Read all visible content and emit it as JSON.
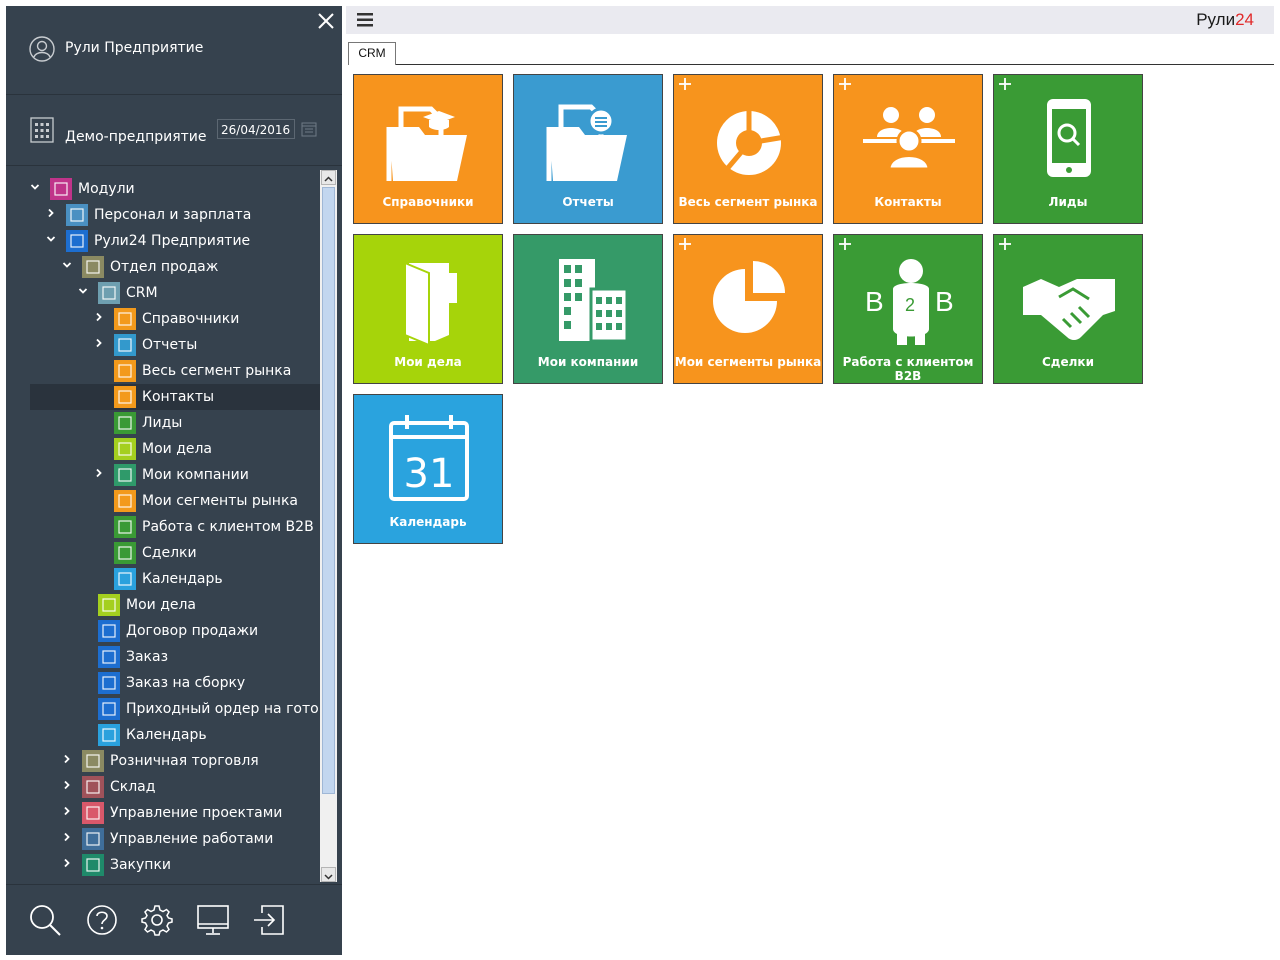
{
  "user": {
    "name": "Рули Предприятие"
  },
  "company": {
    "name": "Демо-предприятие",
    "date": "26/04/2016"
  },
  "tree": [
    {
      "label": "Модули",
      "icon": "modules-icon",
      "color": "#c0348a",
      "arrow": "down"
    },
    {
      "label": "Персонал и зарплата",
      "icon": "personnel-icon",
      "color": "#4a90c2",
      "arrow": "right"
    },
    {
      "label": "Рули24 Предприятие",
      "icon": "enterprise-icon",
      "color": "#1d6ed0",
      "arrow": "down"
    },
    {
      "label": "Отдел продаж",
      "icon": "sales-dept-icon",
      "color": "#8b8a62",
      "arrow": "down"
    },
    {
      "label": "CRM",
      "icon": "crm-icon",
      "color": "#6e9fb0",
      "arrow": "down"
    },
    {
      "label": "Справочники",
      "icon": "folder-icon",
      "color": "#f39a1c",
      "arrow": "right"
    },
    {
      "label": "Отчеты",
      "icon": "reports-icon",
      "color": "#3399cc",
      "arrow": "right"
    },
    {
      "label": "Весь сегмент рынка",
      "icon": "donut-icon",
      "color": "#f39a1c",
      "arrow": ""
    },
    {
      "label": "Контакты",
      "icon": "contacts-icon",
      "color": "#f39a1c",
      "arrow": ""
    },
    {
      "label": "Лиды",
      "icon": "phone-icon",
      "color": "#3a9a35",
      "arrow": ""
    },
    {
      "label": "Мои дела",
      "icon": "my-tasks-icon",
      "color": "#a4cf1f",
      "arrow": ""
    },
    {
      "label": "Мои компании",
      "icon": "building-icon",
      "color": "#2f9a6a",
      "arrow": "right"
    },
    {
      "label": "Мои сегменты рынка",
      "icon": "pie-icon",
      "color": "#f39a1c",
      "arrow": ""
    },
    {
      "label": "Работа с клиентом B2B",
      "icon": "b2b-icon",
      "color": "#3a9a35",
      "arrow": ""
    },
    {
      "label": "Сделки",
      "icon": "handshake-icon",
      "color": "#3a9a35",
      "arrow": ""
    },
    {
      "label": "Календарь",
      "icon": "calendar-icon",
      "color": "#2aa1dd",
      "arrow": ""
    },
    {
      "label": "Мои дела",
      "icon": "my-tasks-icon",
      "color": "#a4cf1f",
      "arrow": ""
    },
    {
      "label": "Договор продажи",
      "icon": "contract-icon",
      "color": "#1d6ed0",
      "arrow": ""
    },
    {
      "label": "Заказ",
      "icon": "order-icon",
      "color": "#1d6ed0",
      "arrow": ""
    },
    {
      "label": "Заказ на сборку",
      "icon": "assembly-order-icon",
      "color": "#1d6ed0",
      "arrow": ""
    },
    {
      "label": "Приходный ордер на готовую",
      "icon": "receipt-order-icon",
      "color": "#1d6ed0",
      "arrow": ""
    },
    {
      "label": "Календарь",
      "icon": "calendar-icon",
      "color": "#2aa1dd",
      "arrow": ""
    },
    {
      "label": "Розничная торговля",
      "icon": "retail-icon",
      "color": "#8b8a62",
      "arrow": "right"
    },
    {
      "label": "Склад",
      "icon": "warehouse-icon",
      "color": "#a0525a",
      "arrow": "right"
    },
    {
      "label": "Управление проектами",
      "icon": "projects-icon",
      "color": "#d9586a",
      "arrow": "right"
    },
    {
      "label": "Управление работами",
      "icon": "works-icon",
      "color": "#3f6e9a",
      "arrow": "right"
    },
    {
      "label": "Закупки",
      "icon": "purchases-icon",
      "color": "#1f8a6a",
      "arrow": "right"
    }
  ],
  "topbar": {
    "brand_a": "Рули",
    "brand_b": "24"
  },
  "tabs": [
    {
      "label": "CRM"
    }
  ],
  "tiles": [
    {
      "label": "Справочники",
      "color": "#f7941d",
      "icon": "folder-graduation-icon",
      "plus": false
    },
    {
      "label": "Отчеты",
      "color": "#3a9bd0",
      "icon": "folder-reports-icon",
      "plus": false
    },
    {
      "label": "Весь сегмент рынка",
      "color": "#f7941d",
      "icon": "donut-chart-icon",
      "plus": true
    },
    {
      "label": "Контакты",
      "color": "#f7941d",
      "icon": "contacts-icon",
      "plus": true
    },
    {
      "label": "Лиды",
      "color": "#3a9b35",
      "icon": "phone-search-icon",
      "plus": true
    },
    {
      "label": "Мои дела",
      "color": "#a6d40a",
      "icon": "folder-tasks-icon",
      "plus": false
    },
    {
      "label": "Мои компании",
      "color": "#359a68",
      "icon": "buildings-icon",
      "plus": false
    },
    {
      "label": "Мои сегменты рынка",
      "color": "#f7941d",
      "icon": "pie-chart-icon",
      "plus": true
    },
    {
      "label": "Работа с клиентом B2B",
      "color": "#3a9b35",
      "icon": "b2b-person-icon",
      "plus": true
    },
    {
      "label": "Сделки",
      "color": "#3a9b35",
      "icon": "handshake-icon",
      "plus": true
    },
    {
      "label": "Календарь",
      "color": "#2aa3de",
      "icon": "calendar-icon",
      "plus": false
    }
  ],
  "tile_icon_text": {
    "b2b_left": "B",
    "b2b_mid": "2",
    "b2b_right": "B",
    "calendar_day": "31"
  }
}
